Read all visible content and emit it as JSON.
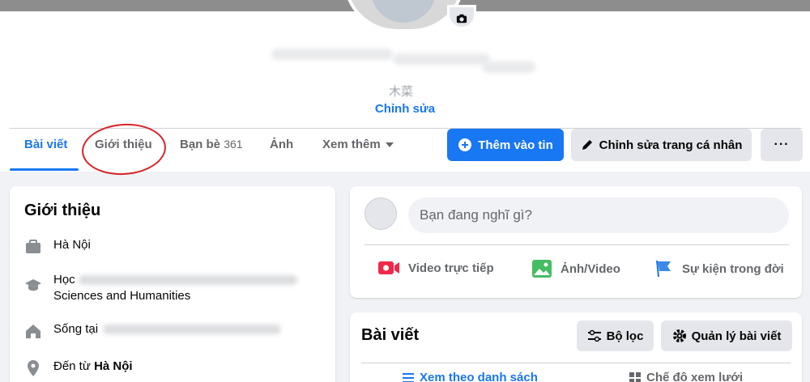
{
  "profile": {
    "nickname": "木菜",
    "edit_label": "Chỉnh sửa"
  },
  "tabs": [
    {
      "label": "Bài viết"
    },
    {
      "label": "Giới thiệu"
    },
    {
      "label": "Bạn bè",
      "count": "361"
    },
    {
      "label": "Ảnh"
    },
    {
      "label": "Xem thêm"
    }
  ],
  "actions": {
    "add_story": "Thêm vào tin",
    "edit_profile": "Chỉnh sửa trang cá nhân",
    "more": "···"
  },
  "intro": {
    "title": "Giới thiệu",
    "work": "Hà Nội",
    "study_prefix": "Học",
    "study_suffix": "Sciences and Humanities",
    "lives_prefix": "Sống tại",
    "from_prefix": "Đến từ",
    "from_city": "Hà Nội"
  },
  "composer": {
    "placeholder": "Bạn đang nghĩ gì?",
    "live_video": "Video trực tiếp",
    "photo_video": "Ảnh/Video",
    "life_event": "Sự kiện trong đời"
  },
  "posts": {
    "title": "Bài viết",
    "filter": "Bộ lọc",
    "manage": "Quản lý bài viết",
    "list_view": "Xem theo danh sách",
    "grid_view": "Chế độ xem lưới"
  },
  "colors": {
    "accent": "#1877f2",
    "annotation": "#d9232a"
  }
}
